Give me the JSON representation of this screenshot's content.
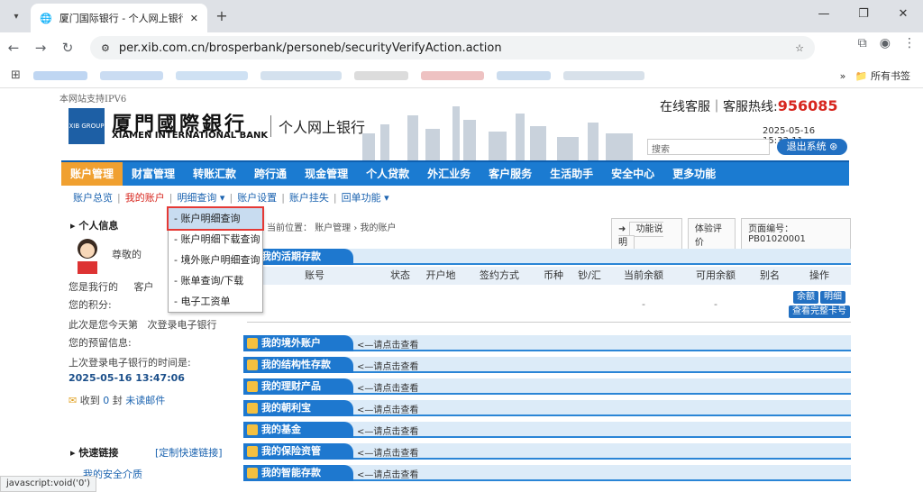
{
  "browser": {
    "tab_title": "厦门国际银行 - 个人网上银行1.0",
    "url": "per.xib.com.cn/brosperbank/personeb/securityVerifyAction.action",
    "all_bookmarks": "所有书签",
    "status_text": "javascript:void('0')"
  },
  "header": {
    "ipv6": "本网站支持IPV6",
    "logo_label": "XIB GROUP",
    "bank_cn": "厦門國際銀行",
    "bank_en": "XIAMEN INTERNATIONAL BANK",
    "subtitle": "个人网上银行",
    "service_label": "在线客服｜客服热线:",
    "service_number": "956085",
    "datetime": "2025-05-16 15:33:11",
    "search_placeholder": "搜索",
    "logout": "退出系统"
  },
  "main_nav": [
    {
      "label": "账户管理",
      "active": true
    },
    {
      "label": "财富管理"
    },
    {
      "label": "转账汇款"
    },
    {
      "label": "跨行通"
    },
    {
      "label": "现金管理"
    },
    {
      "label": "个人贷款"
    },
    {
      "label": "外汇业务"
    },
    {
      "label": "客户服务"
    },
    {
      "label": "生活助手"
    },
    {
      "label": "安全中心"
    },
    {
      "label": "更多功能"
    }
  ],
  "sub_nav": [
    "账户总览",
    "我的账户",
    "明细查询 ▾",
    "账户设置",
    "账户挂失",
    "回单功能 ▾"
  ],
  "dropdown": [
    "- 账户明细查询",
    "- 账户明细下载查询",
    "- 境外账户明细查询",
    "- 账单查询/下载",
    "- 电子工资单"
  ],
  "left": {
    "title": "个人信息",
    "greeting": "尊敬的",
    "l1a": "您是我行的",
    "l1b": "客户",
    "l2": "您的积分:",
    "l3a": "此次是您今天第",
    "l3b": "次登录电子银行",
    "l4": "您的预留信息:",
    "l5": "上次登录电子银行的时间是:",
    "last_login": "2025-05-16 13:47:06",
    "mail_a": "收到",
    "mail_count": "0",
    "mail_b": "封",
    "mail_c": "未读邮件",
    "quick_title": "快速链接",
    "quick_custom": "[定制快速链接]",
    "quick_item": "我的安全介质"
  },
  "right": {
    "crumb": "当前位置： 账户管理 › 我的账户",
    "btn_help": "功能说明",
    "btn_eval": "体验评价",
    "page_no": "页面编号：PB01020001",
    "hint": "<—请点击查看",
    "active_section": "我的活期存款",
    "columns": [
      "账号",
      "状态",
      "开户地",
      "签约方式",
      "币种",
      "钞/汇",
      "当前余额",
      "可用余额",
      "别名",
      "操作"
    ],
    "row_dash1": "-",
    "row_dash2": "-",
    "action1": "余额",
    "action2": "明细",
    "action3": "查看完整卡号",
    "sections": [
      "我的境外账户",
      "我的结构性存款",
      "我的理财产品",
      "我的朝利宝",
      "我的基金",
      "我的保险资管",
      "我的智能存款"
    ]
  }
}
